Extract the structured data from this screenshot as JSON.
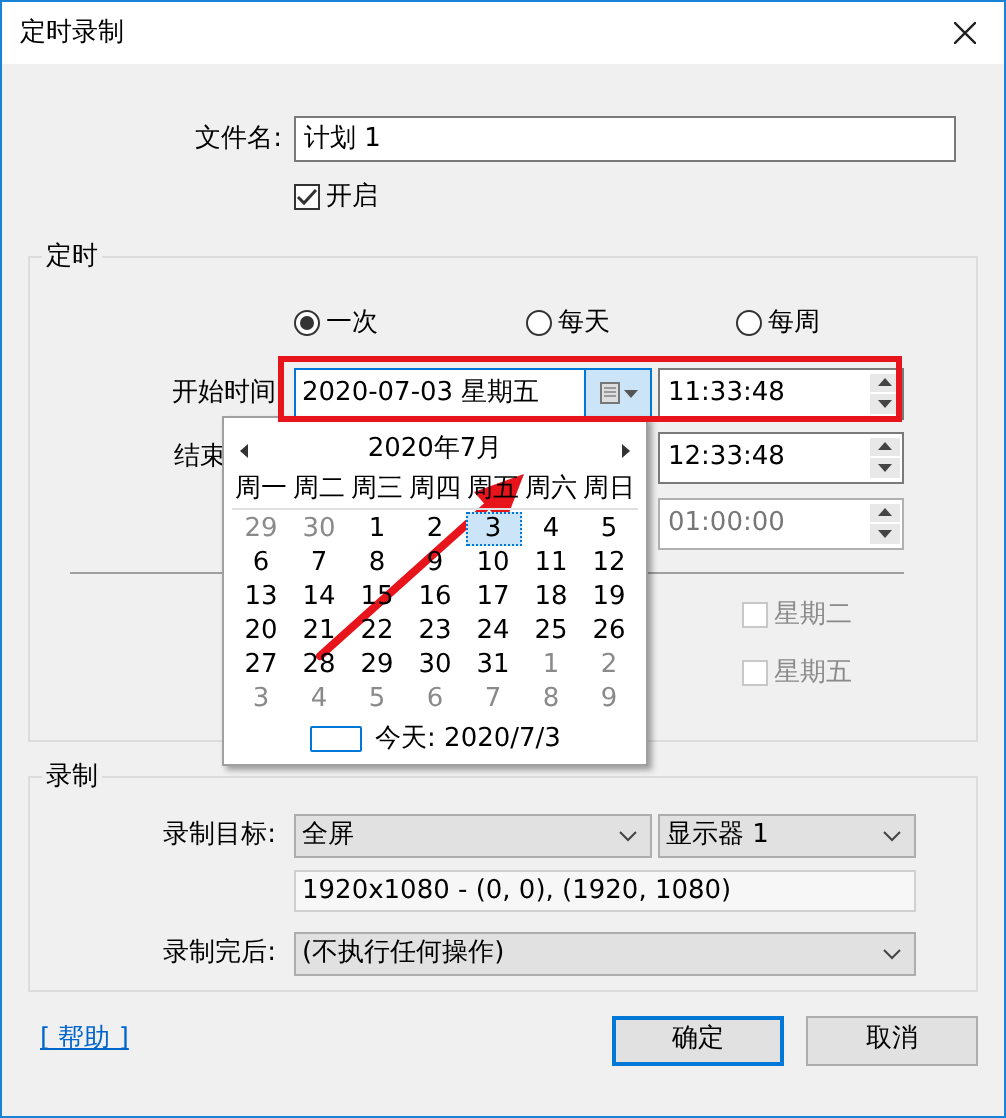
{
  "window": {
    "title": "定时录制"
  },
  "file_name": {
    "label": "文件名:",
    "value": "计划 1"
  },
  "enabled": {
    "label": "开启",
    "checked": true
  },
  "schedule": {
    "title": "定时",
    "repeat": [
      {
        "label": "一次",
        "selected": true
      },
      {
        "label": "每天",
        "selected": false
      },
      {
        "label": "每周",
        "selected": false
      }
    ],
    "start": {
      "label": "开始时间",
      "date": "2020-07-03 星期五",
      "time": "11:33:48"
    },
    "end": {
      "label": "结束",
      "time": "12:33:48"
    },
    "duration": {
      "time": "01:00:00",
      "disabled": true
    },
    "weekdays": [
      {
        "label": "星期二",
        "checked": false,
        "disabled": true
      },
      {
        "label": "星期五",
        "checked": false,
        "disabled": true
      }
    ]
  },
  "calendar": {
    "month": "2020年7月",
    "weekdays": [
      "周一",
      "周二",
      "周三",
      "周四",
      "周五",
      "周六",
      "周日"
    ],
    "weeks": [
      [
        {
          "label": "29",
          "outside": true,
          "selected": false
        },
        {
          "label": "30",
          "outside": true,
          "selected": false
        },
        {
          "label": "1",
          "outside": false,
          "selected": false
        },
        {
          "label": "2",
          "outside": false,
          "selected": false
        },
        {
          "label": "3",
          "outside": false,
          "selected": true
        },
        {
          "label": "4",
          "outside": false,
          "selected": false
        },
        {
          "label": "5",
          "outside": false,
          "selected": false
        }
      ],
      [
        {
          "label": "6",
          "outside": false,
          "selected": false
        },
        {
          "label": "7",
          "outside": false,
          "selected": false
        },
        {
          "label": "8",
          "outside": false,
          "selected": false
        },
        {
          "label": "9",
          "outside": false,
          "selected": false
        },
        {
          "label": "10",
          "outside": false,
          "selected": false
        },
        {
          "label": "11",
          "outside": false,
          "selected": false
        },
        {
          "label": "12",
          "outside": false,
          "selected": false
        }
      ],
      [
        {
          "label": "13",
          "outside": false,
          "selected": false
        },
        {
          "label": "14",
          "outside": false,
          "selected": false
        },
        {
          "label": "15",
          "outside": false,
          "selected": false
        },
        {
          "label": "16",
          "outside": false,
          "selected": false
        },
        {
          "label": "17",
          "outside": false,
          "selected": false
        },
        {
          "label": "18",
          "outside": false,
          "selected": false
        },
        {
          "label": "19",
          "outside": false,
          "selected": false
        }
      ],
      [
        {
          "label": "20",
          "outside": false,
          "selected": false
        },
        {
          "label": "21",
          "outside": false,
          "selected": false
        },
        {
          "label": "22",
          "outside": false,
          "selected": false
        },
        {
          "label": "23",
          "outside": false,
          "selected": false
        },
        {
          "label": "24",
          "outside": false,
          "selected": false
        },
        {
          "label": "25",
          "outside": false,
          "selected": false
        },
        {
          "label": "26",
          "outside": false,
          "selected": false
        }
      ],
      [
        {
          "label": "27",
          "outside": false,
          "selected": false
        },
        {
          "label": "28",
          "outside": false,
          "selected": false
        },
        {
          "label": "29",
          "outside": false,
          "selected": false
        },
        {
          "label": "30",
          "outside": false,
          "selected": false
        },
        {
          "label": "31",
          "outside": false,
          "selected": false
        },
        {
          "label": "1",
          "outside": true,
          "selected": false
        },
        {
          "label": "2",
          "outside": true,
          "selected": false
        }
      ],
      [
        {
          "label": "3",
          "outside": true,
          "selected": false
        },
        {
          "label": "4",
          "outside": true,
          "selected": false
        },
        {
          "label": "5",
          "outside": true,
          "selected": false
        },
        {
          "label": "6",
          "outside": true,
          "selected": false
        },
        {
          "label": "7",
          "outside": true,
          "selected": false
        },
        {
          "label": "8",
          "outside": true,
          "selected": false
        },
        {
          "label": "9",
          "outside": true,
          "selected": false
        }
      ]
    ],
    "today": "今天: 2020/7/3"
  },
  "recording": {
    "title": "录制",
    "target_label": "录制目标:",
    "target": "全屏",
    "display": "显示器 1",
    "region": "1920x1080 - (0, 0), (1920, 1080)",
    "after_label": "录制完后:",
    "after": "(不执行任何操作)"
  },
  "help_link": "[ 帮助 ]",
  "buttons": [
    {
      "label": "确定",
      "default": true
    },
    {
      "label": "取消",
      "default": false
    }
  ]
}
